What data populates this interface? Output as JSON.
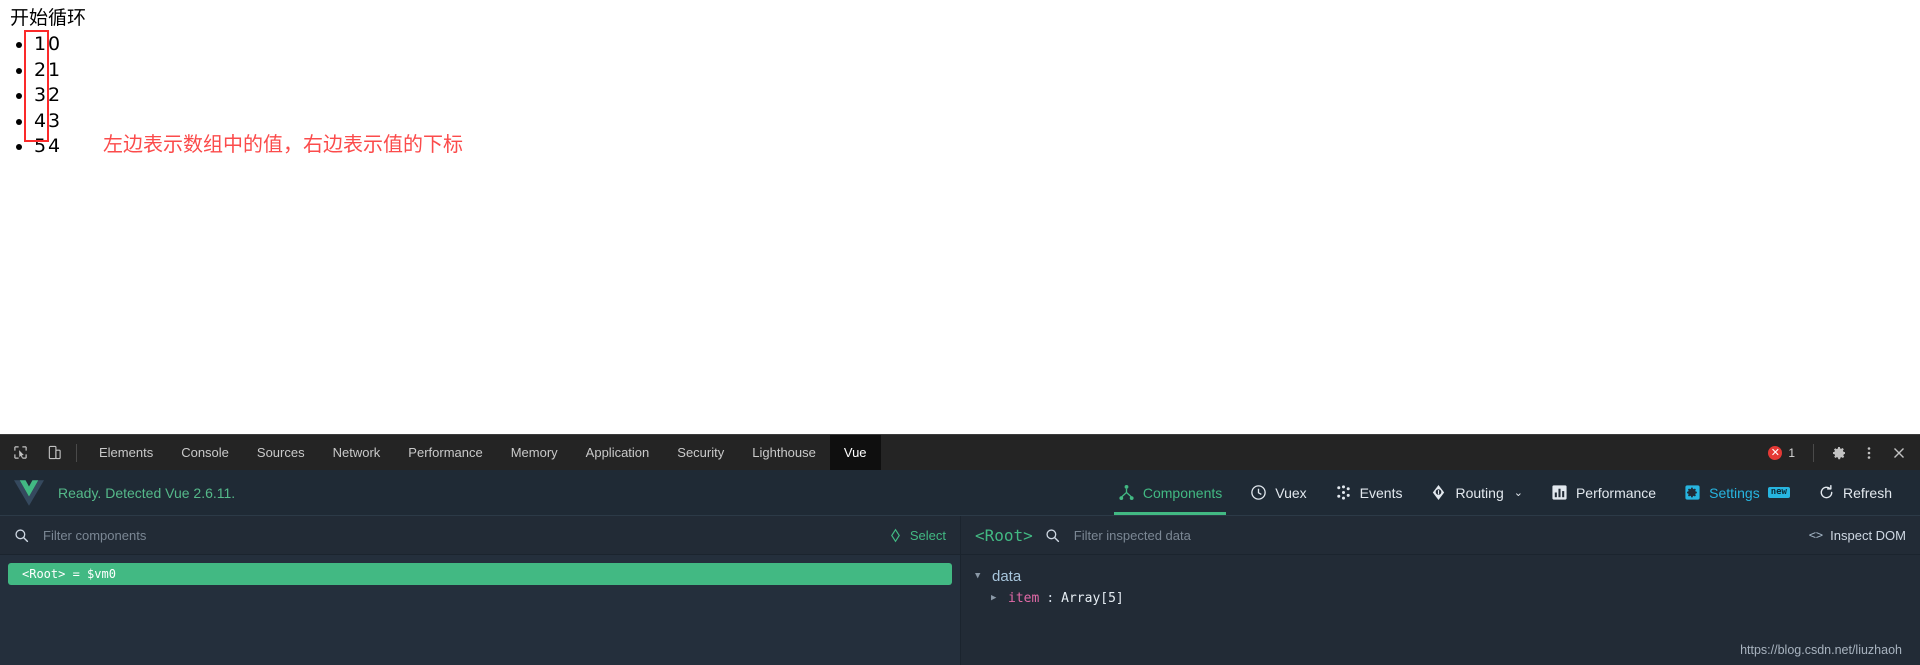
{
  "page": {
    "heading": "开始循环",
    "list": [
      {
        "value": "1",
        "index": "0"
      },
      {
        "value": "2",
        "index": "1"
      },
      {
        "value": "3",
        "index": "2"
      },
      {
        "value": "4",
        "index": "3"
      },
      {
        "value": "5",
        "index": "4"
      }
    ],
    "annotation": "左边表示数组中的值，右边表示值的下标",
    "annotation_color": "#fb4b4b",
    "highlight_box_color": "#fb2a2a"
  },
  "devtools": {
    "icons": {
      "inspect": "inspect-element-icon",
      "device": "device-toolbar-icon",
      "settings": "gear-icon",
      "more": "more-options-icon",
      "close": "close-icon"
    },
    "tabs": [
      {
        "label": "Elements",
        "active": false
      },
      {
        "label": "Console",
        "active": false
      },
      {
        "label": "Sources",
        "active": false
      },
      {
        "label": "Network",
        "active": false
      },
      {
        "label": "Performance",
        "active": false
      },
      {
        "label": "Memory",
        "active": false
      },
      {
        "label": "Application",
        "active": false
      },
      {
        "label": "Security",
        "active": false
      },
      {
        "label": "Lighthouse",
        "active": false
      },
      {
        "label": "Vue",
        "active": true
      }
    ],
    "error_badge": {
      "symbol": "✕",
      "count": "1",
      "color": "#e53935"
    }
  },
  "vue": {
    "status": "Ready. Detected Vue 2.6.11.",
    "accent": "#42b983",
    "settings_accent": "#27b5e0",
    "nav": [
      {
        "label": "Components",
        "icon": "components-icon",
        "active": true
      },
      {
        "label": "Vuex",
        "icon": "vuex-icon",
        "active": false
      },
      {
        "label": "Events",
        "icon": "events-icon",
        "active": false
      },
      {
        "label": "Routing",
        "icon": "routing-icon",
        "active": false,
        "chevron": "⌄"
      },
      {
        "label": "Performance",
        "icon": "performance-icon",
        "active": false
      },
      {
        "label": "Settings",
        "icon": "settings-icon",
        "active": false,
        "badge": "new"
      },
      {
        "label": "Refresh",
        "icon": "refresh-icon",
        "active": false
      }
    ],
    "left": {
      "filter_placeholder": "Filter components",
      "filter_value": "",
      "select_label": "Select",
      "tree": [
        {
          "name": "<Root> = $vm0",
          "selected": true
        }
      ]
    },
    "right": {
      "root_label": "<Root>",
      "filter_placeholder": "Filter inspected data",
      "filter_value": "",
      "inspect_dom_label": "Inspect DOM",
      "data": [
        {
          "group": "data",
          "expanded": true,
          "items": [
            {
              "key": "item",
              "value": "Array[5]",
              "expanded": false
            }
          ]
        }
      ]
    }
  },
  "watermark": "https://blog.csdn.net/liuzhaoh"
}
